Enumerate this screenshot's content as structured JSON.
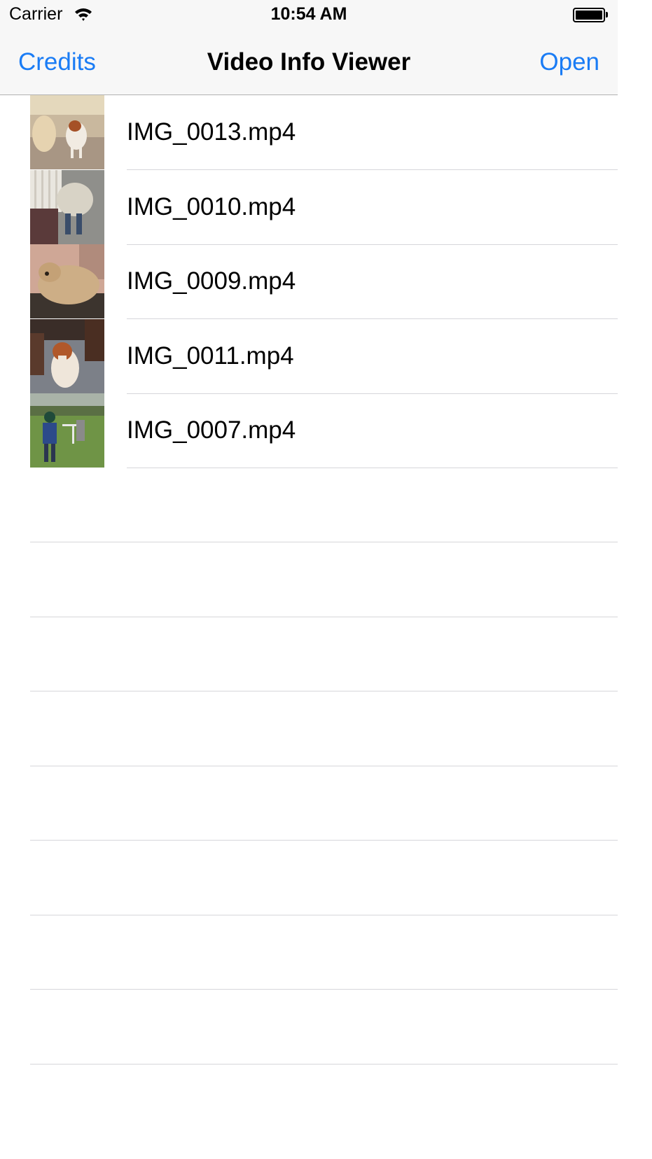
{
  "status_bar": {
    "carrier": "Carrier",
    "time": "10:54 AM"
  },
  "nav": {
    "left_button": "Credits",
    "title": "Video Info Viewer",
    "right_button": "Open"
  },
  "accent_color": "#1a7cf5",
  "videos": [
    {
      "name": "IMG_0013.mp4",
      "thumbnail": "two-dogs-thumbnail"
    },
    {
      "name": "IMG_0010.mp4",
      "thumbnail": "doodle-on-porch-thumbnail"
    },
    {
      "name": "IMG_0009.mp4",
      "thumbnail": "doodle-lying-thumbnail"
    },
    {
      "name": "IMG_0011.mp4",
      "thumbnail": "spaniel-sitting-thumbnail"
    },
    {
      "name": "IMG_0007.mp4",
      "thumbnail": "golfer-thumbnail"
    }
  ]
}
